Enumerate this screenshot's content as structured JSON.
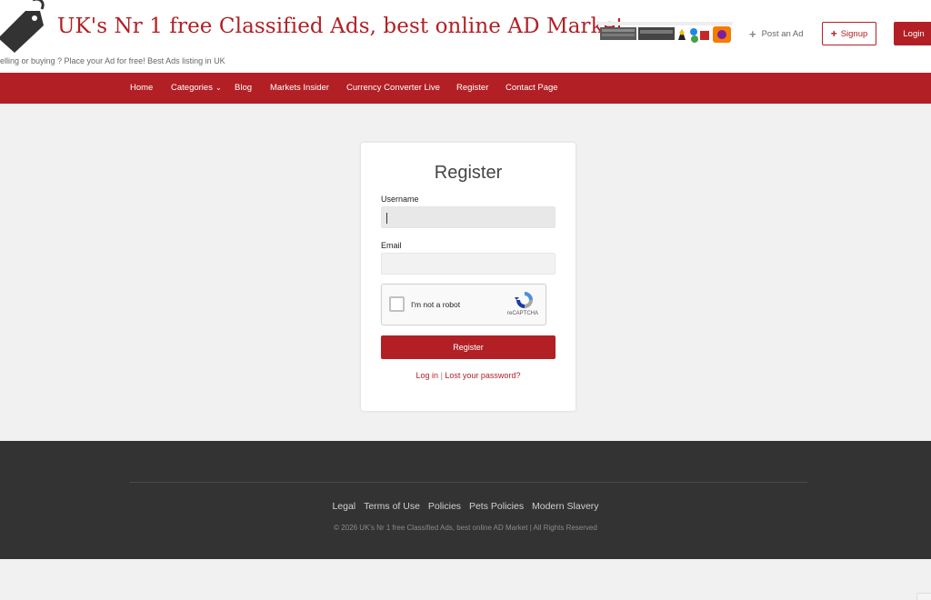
{
  "header": {
    "site_title": "UK's Nr 1 free Classified Ads, best online AD Market",
    "tagline": "elling or buying ? Place your Ad for free! Best Ads listing in UK",
    "post_ad_label": "Post an Ad",
    "signup_label": "Signup",
    "login_label": "Login"
  },
  "nav": {
    "items": [
      {
        "label": "Home"
      },
      {
        "label": "Categories"
      },
      {
        "label": "Blog"
      },
      {
        "label": "Markets Insider"
      },
      {
        "label": "Currency Converter Live"
      },
      {
        "label": "Register"
      },
      {
        "label": "Contact Page"
      }
    ]
  },
  "register": {
    "title": "Register",
    "username_label": "Username",
    "username_value": "",
    "email_label": "Email",
    "email_value": "",
    "recaptcha_text": "I'm not a robot",
    "recaptcha_brand": "reCAPTCHA",
    "submit_label": "Register",
    "login_link": "Log in",
    "separator": " | ",
    "lost_password_link": "Lost your password?"
  },
  "footer": {
    "links": [
      {
        "label": "Legal"
      },
      {
        "label": "Terms of Use"
      },
      {
        "label": "Policies"
      },
      {
        "label": "Pets Policies"
      },
      {
        "label": "Modern Slavery"
      }
    ],
    "copyright": "© 2026 UK's Nr 1 free Classified Ads, best online AD Market | All Rights Reserved"
  },
  "colors": {
    "brand": "#b22025",
    "footer_bg": "#333333",
    "page_bg": "#f1f1f1"
  },
  "icons": {
    "logo": "price-tag-icon",
    "post_ad": "plus-icon",
    "signup": "plus-icon",
    "categories": "chevron-down-icon",
    "recaptcha": "recaptcha-logo-icon"
  }
}
